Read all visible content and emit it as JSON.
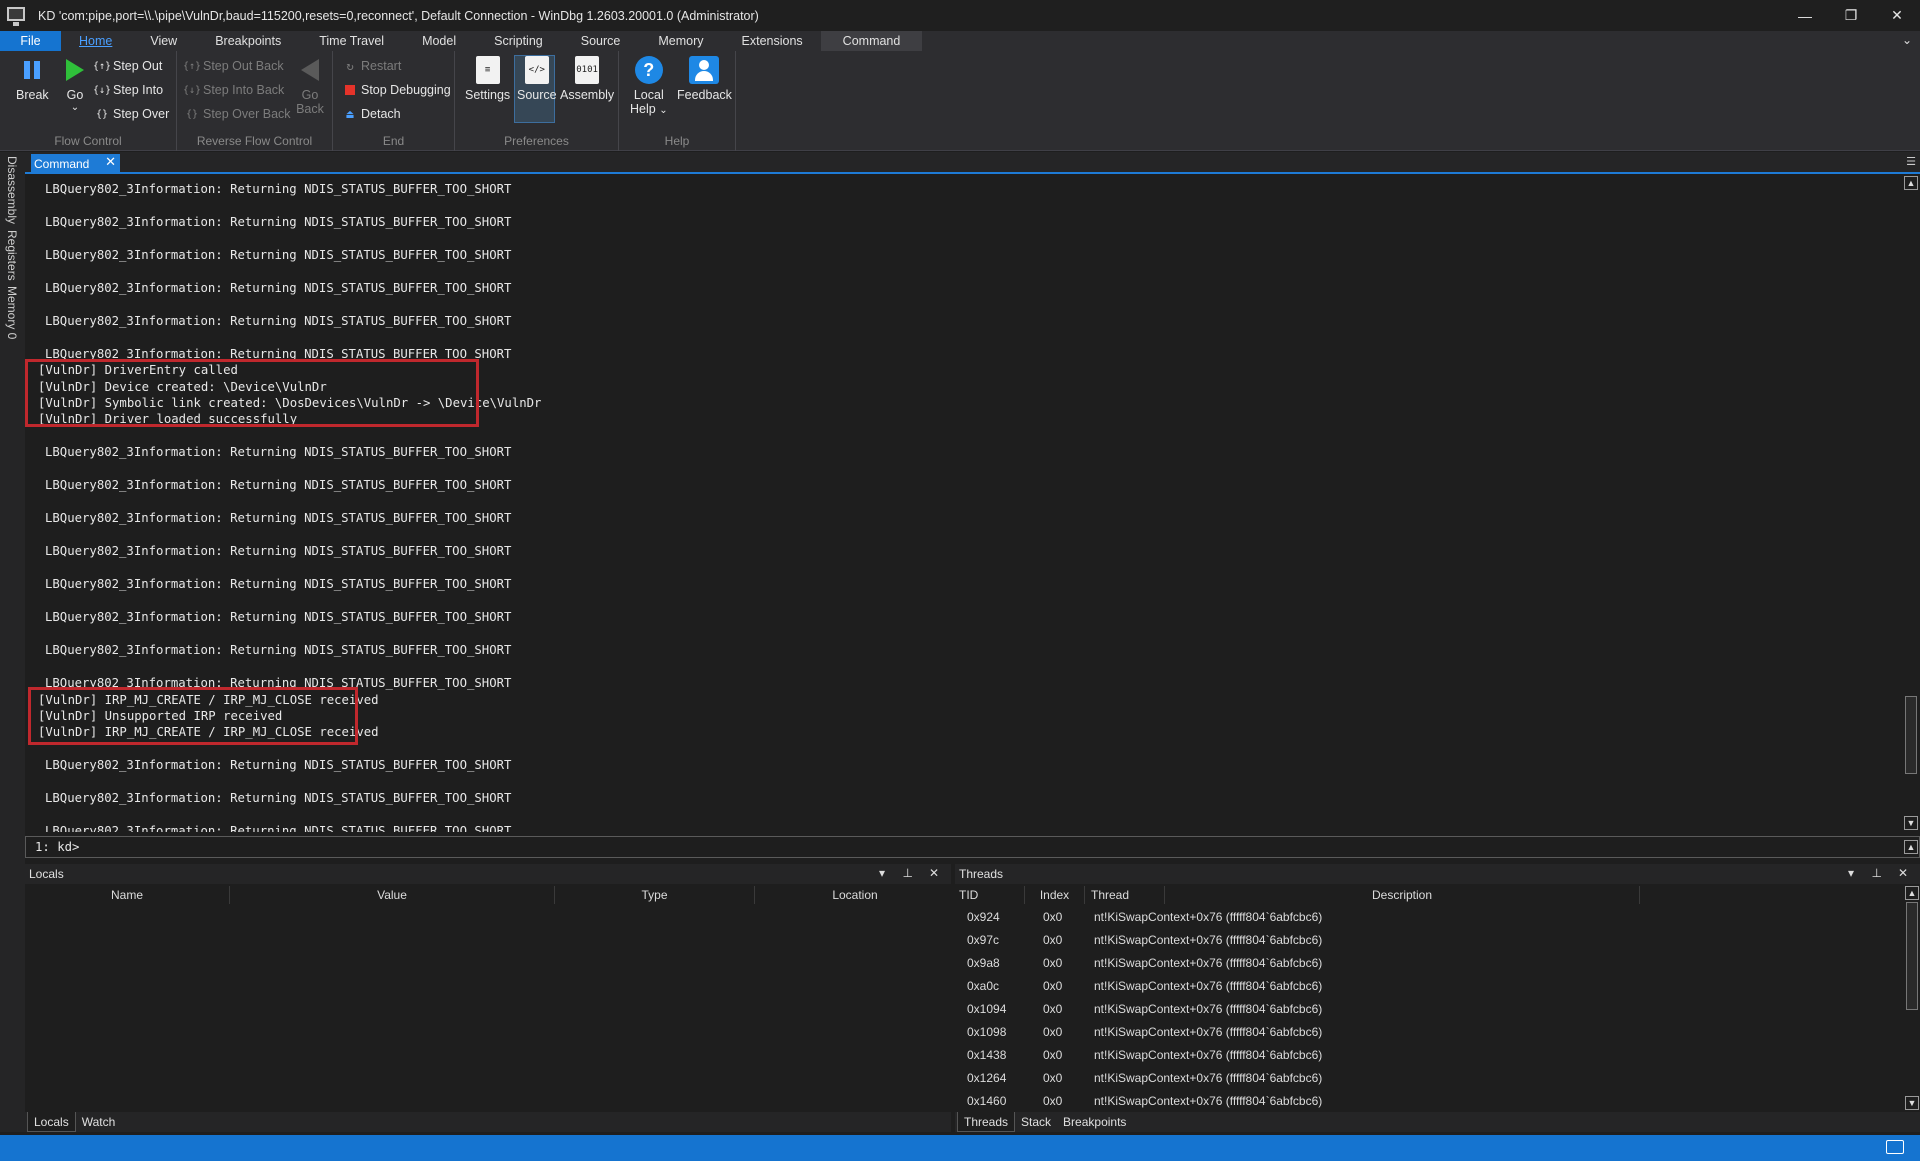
{
  "window": {
    "title": "KD 'com:pipe,port=\\\\.\\pipe\\VulnDr,baud=115200,resets=0,reconnect', Default Connection  - WinDbg 1.2603.20001.0 (Administrator)",
    "minimize": "—",
    "maximize": "❐",
    "close": "✕"
  },
  "menu_tabs": [
    "File",
    "Home",
    "View",
    "Breakpoints",
    "Time Travel",
    "Model",
    "Scripting",
    "Source",
    "Memory",
    "Extensions",
    "Command"
  ],
  "ribbon": {
    "flow_control": {
      "label": "Flow Control",
      "break": "Break",
      "go": "Go",
      "step_out": "Step Out",
      "step_into": "Step Into",
      "step_over": "Step Over"
    },
    "reverse_flow": {
      "label": "Reverse Flow Control",
      "step_out_back": "Step Out Back",
      "step_into_back": "Step Into Back",
      "step_over_back": "Step Over Back",
      "go_back_1": "Go",
      "go_back_2": "Back"
    },
    "end": {
      "label": "End",
      "restart": "Restart",
      "stop_debugging": "Stop Debugging",
      "detach": "Detach"
    },
    "preferences": {
      "label": "Preferences",
      "settings": "Settings",
      "source": "Source",
      "assembly": "Assembly"
    },
    "help": {
      "label": "Help",
      "local_help_1": "Local",
      "local_help_2": "Help",
      "feedback": "Feedback"
    }
  },
  "side_tabs": [
    "Disassembly",
    "Registers",
    "Memory 0"
  ],
  "command": {
    "tab_label": "Command",
    "lines": [
      "LBQuery802_3Information: Returning NDIS_STATUS_BUFFER_TOO_SHORT",
      "LBQuery802_3Information: Returning NDIS_STATUS_BUFFER_TOO_SHORT",
      "LBQuery802_3Information: Returning NDIS_STATUS_BUFFER_TOO_SHORT",
      "LBQuery802_3Information: Returning NDIS_STATUS_BUFFER_TOO_SHORT",
      "LBQuery802_3Information: Returning NDIS_STATUS_BUFFER_TOO_SHORT",
      "LBQuery802_3Information: Returning NDIS_STATUS_BUFFER_TOO_SHORT",
      "[VulnDr] DriverEntry called",
      "[VulnDr] Device created: \\Device\\VulnDr",
      "[VulnDr] Symbolic link created: \\DosDevices\\VulnDr -> \\Device\\VulnDr",
      "[VulnDr] Driver loaded successfully",
      "LBQuery802_3Information: Returning NDIS_STATUS_BUFFER_TOO_SHORT",
      "LBQuery802_3Information: Returning NDIS_STATUS_BUFFER_TOO_SHORT",
      "LBQuery802_3Information: Returning NDIS_STATUS_BUFFER_TOO_SHORT",
      "LBQuery802_3Information: Returning NDIS_STATUS_BUFFER_TOO_SHORT",
      "LBQuery802_3Information: Returning NDIS_STATUS_BUFFER_TOO_SHORT",
      "LBQuery802_3Information: Returning NDIS_STATUS_BUFFER_TOO_SHORT",
      "LBQuery802_3Information: Returning NDIS_STATUS_BUFFER_TOO_SHORT",
      "LBQuery802_3Information: Returning NDIS_STATUS_BUFFER_TOO_SHORT",
      "[VulnDr] IRP_MJ_CREATE / IRP_MJ_CLOSE received",
      "[VulnDr] Unsupported IRP received",
      "[VulnDr] IRP_MJ_CREATE / IRP_MJ_CLOSE received",
      "LBQuery802_3Information: Returning NDIS_STATUS_BUFFER_TOO_SHORT",
      "LBQuery802_3Information: Returning NDIS_STATUS_BUFFER_TOO_SHORT",
      "LBQuery802_3Information: Returning NDIS_STATUS_BUFFER_TOO_SHORT"
    ],
    "prompt": "1: kd>",
    "input_value": ""
  },
  "locals": {
    "title": "Locals",
    "columns": [
      "Name",
      "Value",
      "Type",
      "Location"
    ],
    "tabs": [
      "Locals",
      "Watch"
    ]
  },
  "threads": {
    "title": "Threads",
    "columns": [
      "TID",
      "Index",
      "Thread",
      "Description"
    ],
    "rows": [
      {
        "tid": "0x924",
        "index": "0x0",
        "thread": "nt!KiSwapContext+0x76 (fffff804`6abfcbc6)"
      },
      {
        "tid": "0x97c",
        "index": "0x0",
        "thread": "nt!KiSwapContext+0x76 (fffff804`6abfcbc6)"
      },
      {
        "tid": "0x9a8",
        "index": "0x0",
        "thread": "nt!KiSwapContext+0x76 (fffff804`6abfcbc6)"
      },
      {
        "tid": "0xa0c",
        "index": "0x0",
        "thread": "nt!KiSwapContext+0x76 (fffff804`6abfcbc6)"
      },
      {
        "tid": "0x1094",
        "index": "0x0",
        "thread": "nt!KiSwapContext+0x76 (fffff804`6abfcbc6)"
      },
      {
        "tid": "0x1098",
        "index": "0x0",
        "thread": "nt!KiSwapContext+0x76 (fffff804`6abfcbc6)"
      },
      {
        "tid": "0x1438",
        "index": "0x0",
        "thread": "nt!KiSwapContext+0x76 (fffff804`6abfcbc6)"
      },
      {
        "tid": "0x1264",
        "index": "0x0",
        "thread": "nt!KiSwapContext+0x76 (fffff804`6abfcbc6)"
      },
      {
        "tid": "0x1460",
        "index": "0x0",
        "thread": "nt!KiSwapContext+0x76 (fffff804`6abfcbc6)"
      }
    ],
    "tabs": [
      "Threads",
      "Stack",
      "Breakpoints"
    ]
  },
  "colors": {
    "accent": "#1574d0",
    "highlight_box": "#c0282d",
    "background": "#1e1e1e"
  }
}
